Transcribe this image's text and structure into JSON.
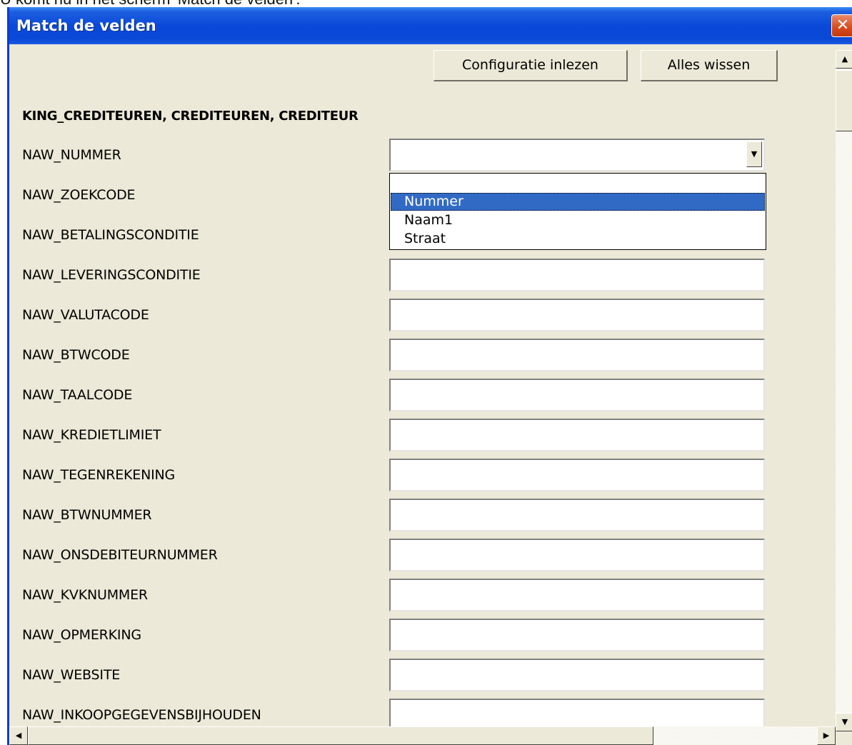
{
  "caption": "U komt nu in het scherm 'Match de velden'.",
  "window": {
    "title": "Match de velden",
    "close_glyph": "✕"
  },
  "toolbar": {
    "load_config_label": "Configuratie inlezen",
    "clear_all_label": "Alles wissen"
  },
  "section": {
    "title": "KING_CREDITEUREN, CREDITEUREN, CREDITEUR"
  },
  "fields": [
    {
      "label": "NAW_NUMMER",
      "value": ""
    },
    {
      "label": "NAW_ZOEKCODE",
      "value": ""
    },
    {
      "label": "NAW_BETALINGSCONDITIE",
      "value": ""
    },
    {
      "label": "NAW_LEVERINGSCONDITIE",
      "value": ""
    },
    {
      "label": "NAW_VALUTACODE",
      "value": ""
    },
    {
      "label": "NAW_BTWCODE",
      "value": ""
    },
    {
      "label": "NAW_TAALCODE",
      "value": ""
    },
    {
      "label": "NAW_KREDIETLIMIET",
      "value": ""
    },
    {
      "label": "NAW_TEGENREKENING",
      "value": ""
    },
    {
      "label": "NAW_BTWNUMMER",
      "value": ""
    },
    {
      "label": "NAW_ONSDEBITEURNUMMER",
      "value": ""
    },
    {
      "label": "NAW_KVKNUMMER",
      "value": ""
    },
    {
      "label": "NAW_OPMERKING",
      "value": ""
    },
    {
      "label": "NAW_WEBSITE",
      "value": ""
    },
    {
      "label": "NAW_INKOOPGEGEVENSBIJHOUDEN",
      "value": ""
    }
  ],
  "dropdown": {
    "selected": "Nummer",
    "options": [
      "",
      "Nummer",
      "Naam1",
      "Straat"
    ]
  },
  "icons": {
    "combo_arrow": "▼",
    "scroll_up": "▲",
    "scroll_down": "▼",
    "scroll_left": "◀",
    "scroll_right": "▶"
  },
  "colors": {
    "titlebar": "#0a49d9",
    "selection": "#316ac5",
    "dialog_bg": "#ece9d8",
    "close": "#d64a1c"
  }
}
